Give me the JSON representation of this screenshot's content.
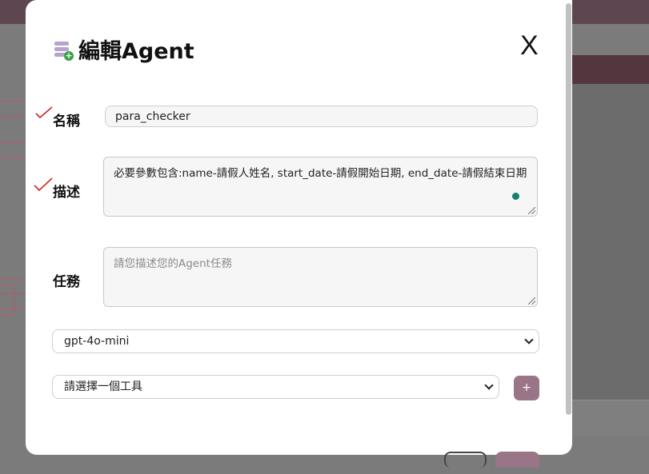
{
  "modal": {
    "title": "編輯Agent",
    "close_label": "X",
    "name_label": "名稱",
    "name_value": "para_checker",
    "description_label": "描述",
    "description_value": "必要參數包含:name-請假人姓名, start_date-請假開始日期, end_date-請假結束日期",
    "task_label": "任務",
    "task_placeholder": "請您描述您的Agent任務",
    "model_selected": "gpt-4o-mini",
    "tool_selected": "請選擇一個工具",
    "add_tool_label": "+"
  },
  "colors": {
    "accent": "#9a7587",
    "topbar": "#5e4651",
    "check_mark": "#d42424",
    "status_dot": "#11806f"
  },
  "icons": [
    "database-add-icon",
    "close-icon",
    "check-mark-icon",
    "chevron-down-icon"
  ]
}
